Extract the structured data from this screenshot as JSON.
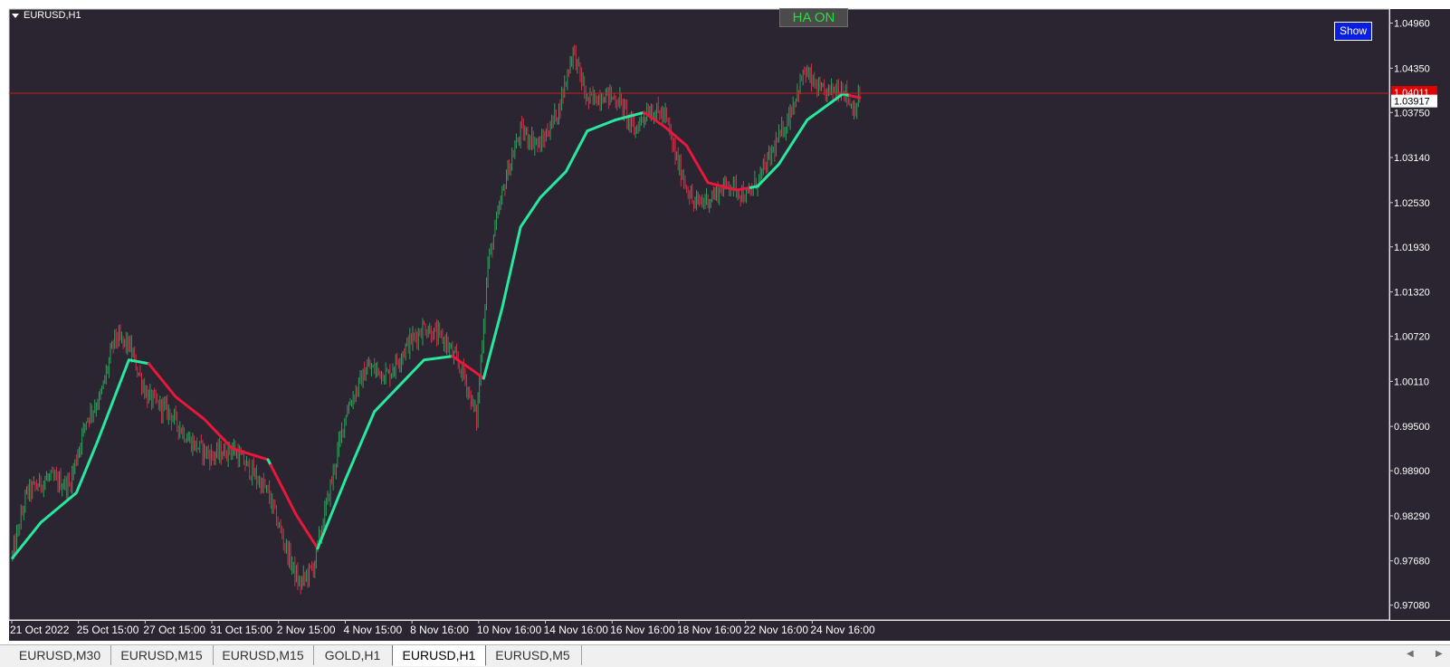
{
  "window": {
    "symbol": "EURUSD,H1",
    "ha_button": "HA ON",
    "show_button": "Show"
  },
  "colors": {
    "background": "#2a2530",
    "grid_border": "#cfcfcf",
    "axis_text": "#ffffff",
    "bull": "#2ea05a",
    "bear": "#d0304a",
    "ma_up": "#28e8a0",
    "ma_down": "#e8173c",
    "bid_line": "#c81e1e",
    "bid_tag": "#e00000"
  },
  "tabs": [
    "EURUSD,M30",
    "EURUSD,M15",
    "EURUSD,M15",
    "GOLD,H1",
    "EURUSD,H1",
    "EURUSD,M5"
  ],
  "active_tab": 4,
  "chart_data": {
    "type": "candlestick",
    "symbol": "EURUSD",
    "timeframe": "H1",
    "y_ticks": [
      1.0496,
      1.0435,
      1.0375,
      1.0314,
      1.0253,
      1.0193,
      1.0132,
      1.0072,
      1.0011,
      0.995,
      0.989,
      0.9829,
      0.9768,
      0.9708
    ],
    "y_tick_labels": [
      "1.04960",
      "1.04350",
      "1.03750",
      "1.03140",
      "1.02530",
      "1.01930",
      "1.01320",
      "1.00720",
      "1.00110",
      "0.99500",
      "0.98900",
      "0.98290",
      "0.97680",
      "0.97080"
    ],
    "ylim": [
      0.9688,
      1.0515
    ],
    "x_tick_labels": [
      "21 Oct 2022",
      "25 Oct 15:00",
      "27 Oct 15:00",
      "31 Oct 15:00",
      "2 Nov 15:00",
      "4 Nov 15:00",
      "8 Nov 16:00",
      "10 Nov 16:00",
      "14 Nov 16:00",
      "16 Nov 16:00",
      "18 Nov 16:00",
      "22 Nov 16:00",
      "24 Nov 16:00"
    ],
    "bar_count": 500,
    "bars_per_label": 47,
    "bid_price": 1.04011,
    "bid_label": "1.04011",
    "last_price": 1.03917,
    "last_label": "1.03917",
    "price_path": [
      [
        0,
        0.9775
      ],
      [
        10,
        0.986
      ],
      [
        25,
        0.988
      ],
      [
        40,
        0.987
      ],
      [
        52,
        0.996
      ],
      [
        62,
        0.999
      ],
      [
        72,
        1.007
      ],
      [
        82,
        1.006
      ],
      [
        95,
        0.999
      ],
      [
        110,
        0.997
      ],
      [
        125,
        0.993
      ],
      [
        140,
        0.991
      ],
      [
        155,
        0.992
      ],
      [
        168,
        0.989
      ],
      [
        180,
        0.986
      ],
      [
        192,
        0.979
      ],
      [
        202,
        0.9735
      ],
      [
        212,
        0.976
      ],
      [
        222,
        0.985
      ],
      [
        235,
        0.997
      ],
      [
        250,
        1.003
      ],
      [
        265,
        1.002
      ],
      [
        278,
        1.006
      ],
      [
        290,
        1.0085
      ],
      [
        305,
        1.0065
      ],
      [
        318,
        1.002
      ],
      [
        327,
        0.996
      ],
      [
        335,
        1.017
      ],
      [
        348,
        1.029
      ],
      [
        358,
        1.035
      ],
      [
        372,
        1.033
      ],
      [
        385,
        1.038
      ],
      [
        395,
        1.046
      ],
      [
        405,
        1.039
      ],
      [
        418,
        1.04
      ],
      [
        428,
        1.039
      ],
      [
        438,
        1.035
      ],
      [
        448,
        1.038
      ],
      [
        460,
        1.037
      ],
      [
        468,
        1.031
      ],
      [
        480,
        1.025
      ],
      [
        492,
        1.026
      ],
      [
        505,
        1.028
      ],
      [
        518,
        1.026
      ],
      [
        530,
        1.03
      ],
      [
        545,
        1.036
      ],
      [
        558,
        1.043
      ],
      [
        570,
        1.04
      ],
      [
        585,
        1.041
      ],
      [
        592,
        1.038
      ],
      [
        597,
        1.0395
      ]
    ],
    "ma_path": [
      [
        0,
        0.9772
      ],
      [
        20,
        0.982
      ],
      [
        45,
        0.986
      ],
      [
        60,
        0.993
      ],
      [
        82,
        1.004
      ],
      [
        96,
        1.0035
      ],
      [
        115,
        0.999
      ],
      [
        135,
        0.996
      ],
      [
        155,
        0.992
      ],
      [
        180,
        0.9905
      ],
      [
        200,
        0.983
      ],
      [
        215,
        0.9785
      ],
      [
        235,
        0.988
      ],
      [
        255,
        0.997
      ],
      [
        275,
        1.001
      ],
      [
        290,
        1.004
      ],
      [
        310,
        1.0045
      ],
      [
        325,
        1.0025
      ],
      [
        332,
        1.0015
      ],
      [
        345,
        1.011
      ],
      [
        358,
        1.022
      ],
      [
        372,
        1.026
      ],
      [
        390,
        1.0295
      ],
      [
        405,
        1.035
      ],
      [
        425,
        1.0365
      ],
      [
        445,
        1.0375
      ],
      [
        460,
        1.0355
      ],
      [
        475,
        1.033
      ],
      [
        490,
        1.028
      ],
      [
        510,
        1.027
      ],
      [
        525,
        1.0275
      ],
      [
        540,
        1.0305
      ],
      [
        560,
        1.0365
      ],
      [
        585,
        1.04
      ],
      [
        597,
        1.0395
      ]
    ],
    "ma_down_ranges": [
      [
        96,
        180
      ],
      [
        182,
        215
      ],
      [
        310,
        332
      ],
      [
        445,
        520
      ],
      [
        590,
        597
      ]
    ]
  }
}
